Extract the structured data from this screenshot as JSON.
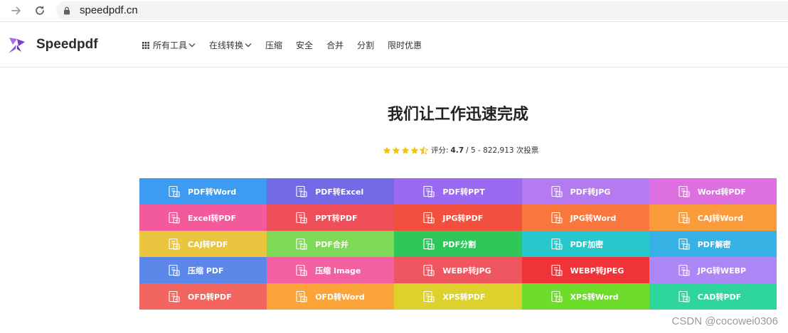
{
  "browser": {
    "url": "speedpdf.cn"
  },
  "header": {
    "logo_text": "Speedpdf",
    "nav": [
      {
        "label": "所有工具",
        "icon": "grid-icon",
        "dropdown": true
      },
      {
        "label": "在线转换",
        "dropdown": true
      },
      {
        "label": "压缩"
      },
      {
        "label": "安全"
      },
      {
        "label": "合并"
      },
      {
        "label": "分割"
      },
      {
        "label": "限时优惠"
      }
    ]
  },
  "hero": {
    "title": "我们让工作迅速完成",
    "rating_prefix": "评分:",
    "rating_value": "4.7",
    "rating_suffix": "/ 5 - 822,913 次投票",
    "stars": 4.7
  },
  "tools": [
    {
      "label": "PDF转Word",
      "color": "#3e9bf2"
    },
    {
      "label": "PDF转Excel",
      "color": "#7469e6"
    },
    {
      "label": "PDF转PPT",
      "color": "#9a6bf2"
    },
    {
      "label": "PDF转JPG",
      "color": "#b57af0"
    },
    {
      "label": "Word转PDF",
      "color": "#dd6fe0"
    },
    {
      "label": "Excel转PDF",
      "color": "#f25a9c"
    },
    {
      "label": "PPT转PDF",
      "color": "#ee4f58"
    },
    {
      "label": "JPG转PDF",
      "color": "#f2503e"
    },
    {
      "label": "JPG转Word",
      "color": "#f8773d"
    },
    {
      "label": "CAJ转Word",
      "color": "#fa9b3c"
    },
    {
      "label": "CAJ转PDF",
      "color": "#e9c540"
    },
    {
      "label": "PDF合并",
      "color": "#7ed957"
    },
    {
      "label": "PDF分割",
      "color": "#2fc75a"
    },
    {
      "label": "PDF加密",
      "color": "#26c8cb"
    },
    {
      "label": "PDF解密",
      "color": "#36b2e5"
    },
    {
      "label": "压缩 PDF",
      "color": "#5b87e8"
    },
    {
      "label": "压缩 Image",
      "color": "#f2609f"
    },
    {
      "label": "WEBP转JPG",
      "color": "#f0565f"
    },
    {
      "label": "WEBP转JPEG",
      "color": "#ee3339"
    },
    {
      "label": "JPG转WEBP",
      "color": "#ad87f6"
    },
    {
      "label": "OFD转PDF",
      "color": "#f2665f"
    },
    {
      "label": "OFD转Word",
      "color": "#fba43a"
    },
    {
      "label": "XPS转PDF",
      "color": "#ddd12e"
    },
    {
      "label": "XPS转Word",
      "color": "#6ddc2b"
    },
    {
      "label": "CAD转PDF",
      "color": "#2fd69b"
    }
  ],
  "watermark": "CSDN @cocowei0306"
}
